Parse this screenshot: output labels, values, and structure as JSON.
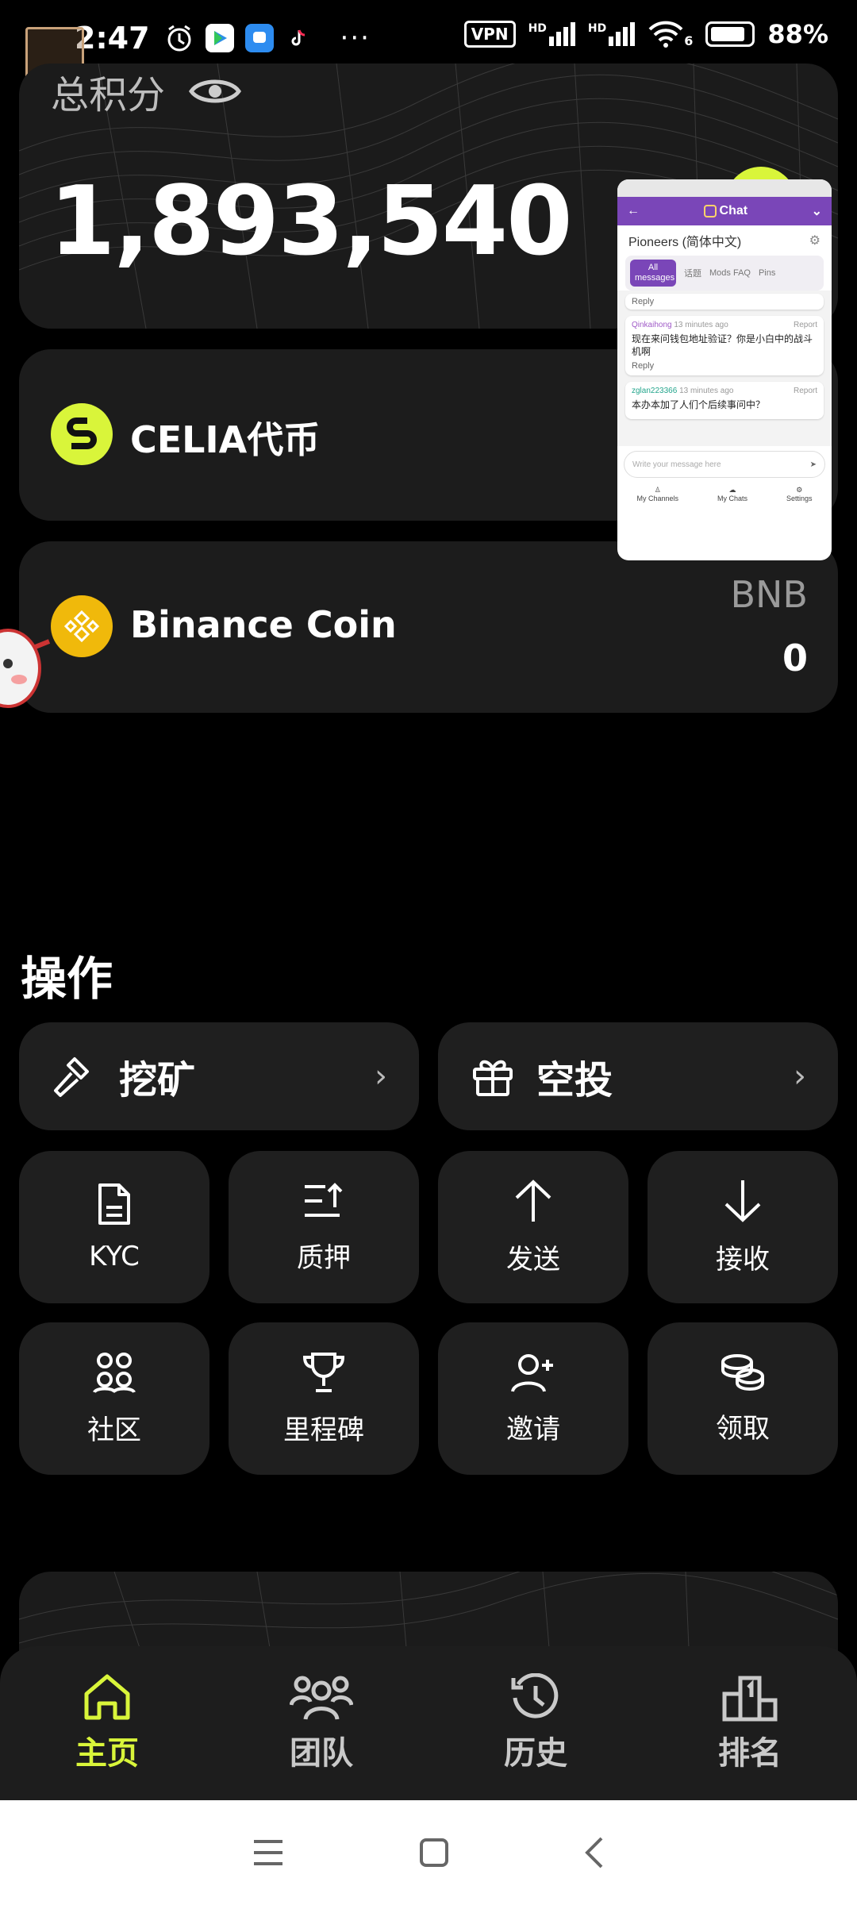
{
  "status_bar": {
    "time": "2:47",
    "dots": "···",
    "vpn": "VPN",
    "hd1": "HD",
    "hd2": "HD",
    "wifi_sub": "6",
    "battery": "88%"
  },
  "total": {
    "title": "总积分",
    "value": "1,893,540"
  },
  "coins": [
    {
      "name": "CELIA代币",
      "symbol": "",
      "balance": ""
    },
    {
      "name": "Binance Coin",
      "symbol": "BNB",
      "balance": "0"
    }
  ],
  "chat": {
    "header": "Chat",
    "room": "Pioneers (简体中文)",
    "tabs": [
      "All messages",
      "话题",
      "Mods FAQ",
      "Pins"
    ],
    "messages": [
      {
        "user": "Qinkaihong",
        "time": "13 minutes ago",
        "report": "Report",
        "text": "现在来问钱包地址验证？你是小白中的战斗机啊",
        "reply": "Reply"
      },
      {
        "user": "zglan223366",
        "time": "13 minutes ago",
        "report": "Report",
        "text": "本办本加了人们个后续事问中？",
        "reply": ""
      }
    ],
    "top_reply": "Reply",
    "input_placeholder": "Write your message here",
    "nav": [
      "My Channels",
      "My Chats",
      "Settings"
    ]
  },
  "operations": {
    "title": "操作",
    "mine": "挖矿",
    "airdrop": "空投",
    "tiles": [
      "KYC",
      "质押",
      "发送",
      "接收",
      "社区",
      "里程碑",
      "邀请",
      "领取"
    ]
  },
  "nav": {
    "items": [
      "主页",
      "团队",
      "历史",
      "排名"
    ],
    "active": 0
  },
  "colors": {
    "accent": "#d9f53a",
    "card": "#1c1c1c",
    "chat_purple": "#7a46b8"
  }
}
